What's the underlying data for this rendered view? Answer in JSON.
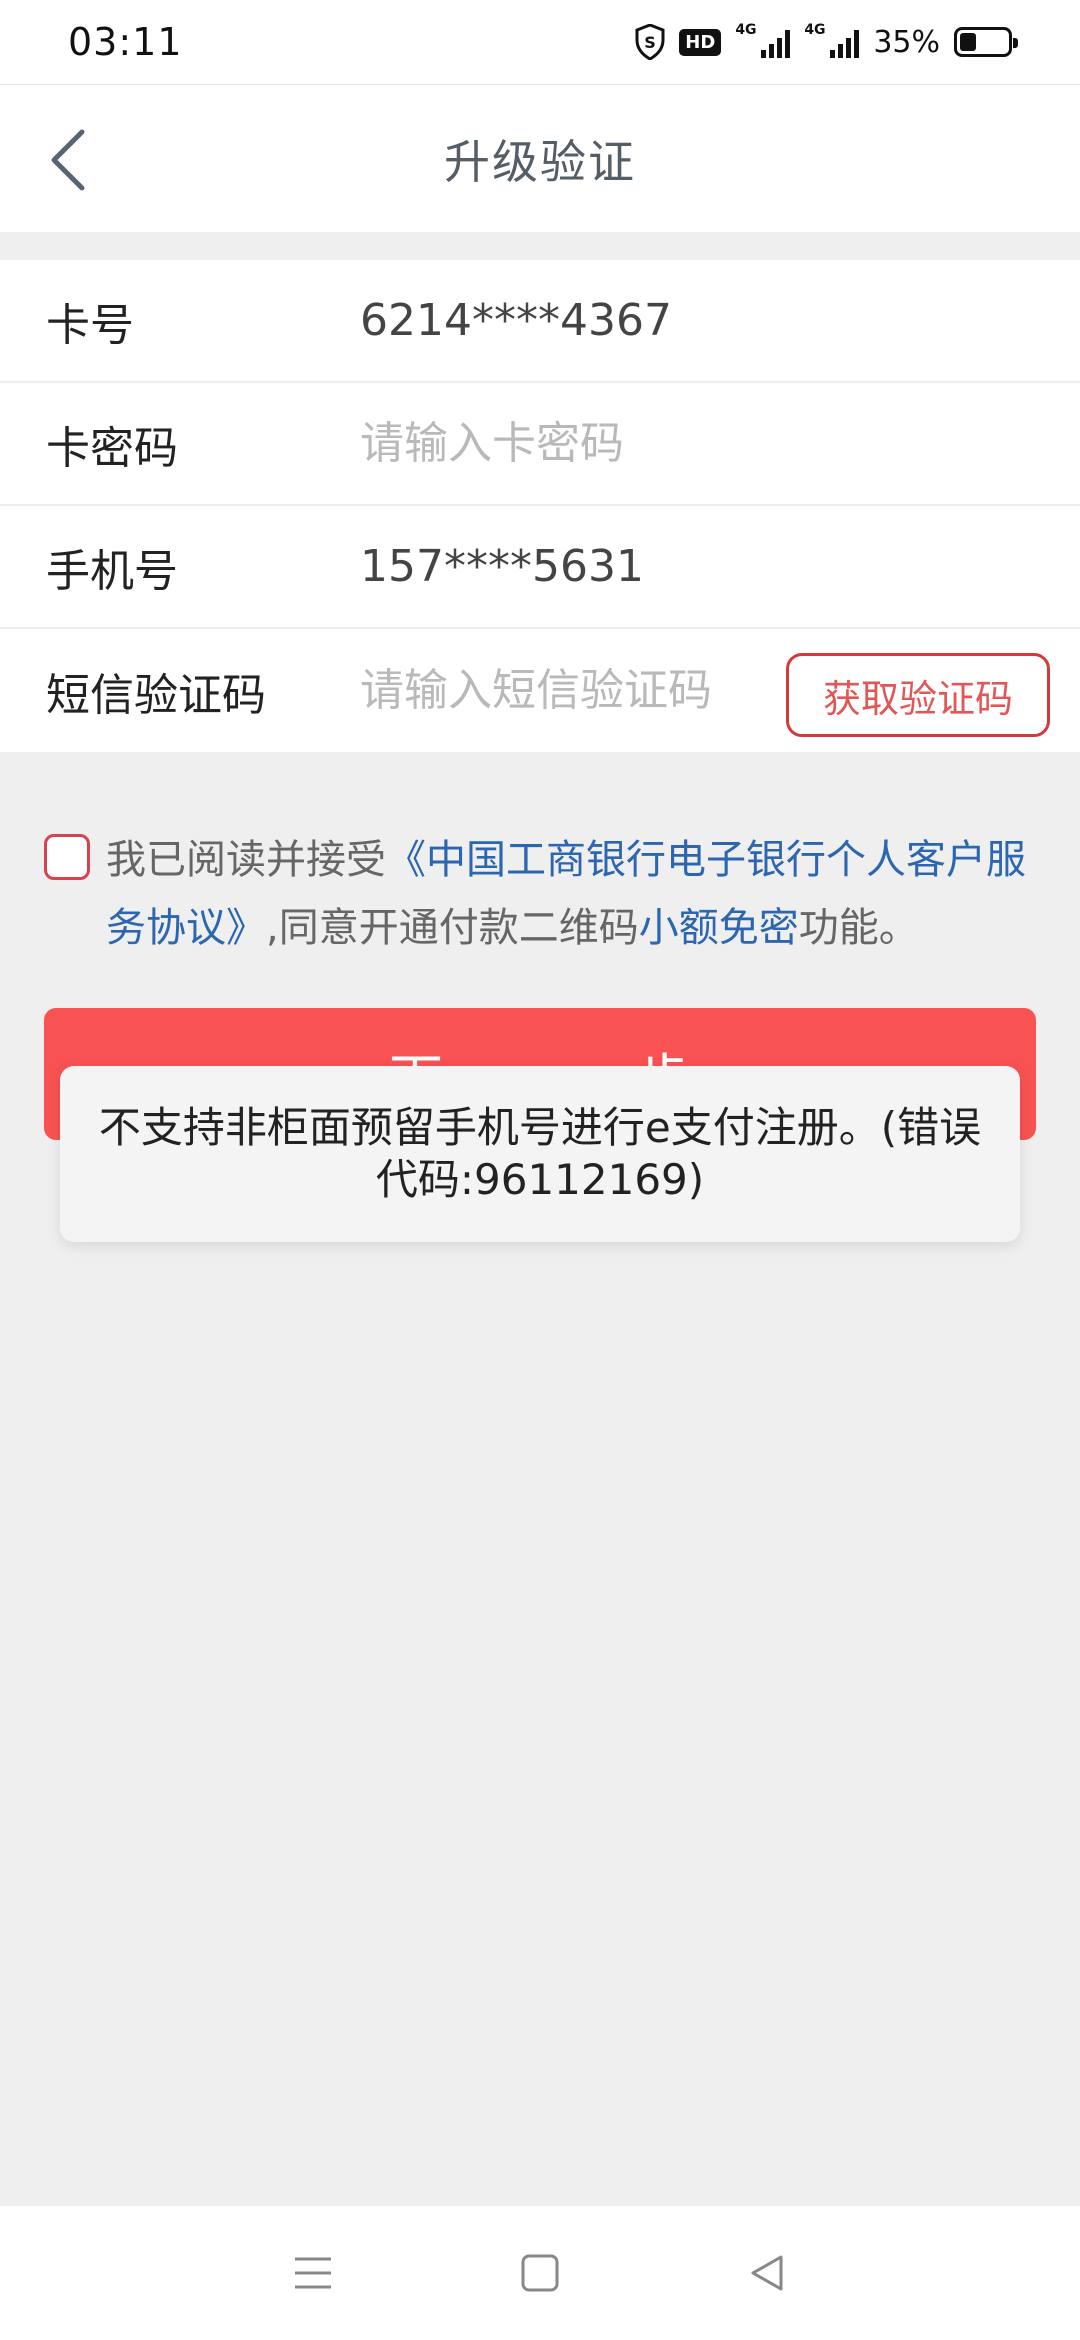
{
  "status_bar": {
    "time": "03:11",
    "hd_label": "HD",
    "network_1": "4G",
    "network_2": "4G",
    "battery_percent": "35%",
    "battery_level": 0.35
  },
  "header": {
    "title": "升级验证"
  },
  "form": {
    "card_label": "卡号",
    "card_value": "6214****4367",
    "password_label": "卡密码",
    "password_placeholder": "请输入卡密码",
    "phone_label": "手机号",
    "phone_value": "157****5631",
    "sms_label": "短信验证码",
    "sms_placeholder": "请输入短信验证码",
    "sms_button": "获取验证码"
  },
  "agreement": {
    "prefix": "我已阅读并接受",
    "agreement_link": "《中国工商银行电子银行个人客户服务协议》",
    "middle": ",同意开通付款二维码",
    "feature_link": "小额免密",
    "suffix": "功能。"
  },
  "next_button": "下一步",
  "toast": {
    "message": "不支持非柜面预留手机号进行e支付注册。(错误代码:96112169)"
  },
  "colors": {
    "accent_red": "#f95252",
    "link_blue": "#2c66b0",
    "background": "#efefef"
  }
}
